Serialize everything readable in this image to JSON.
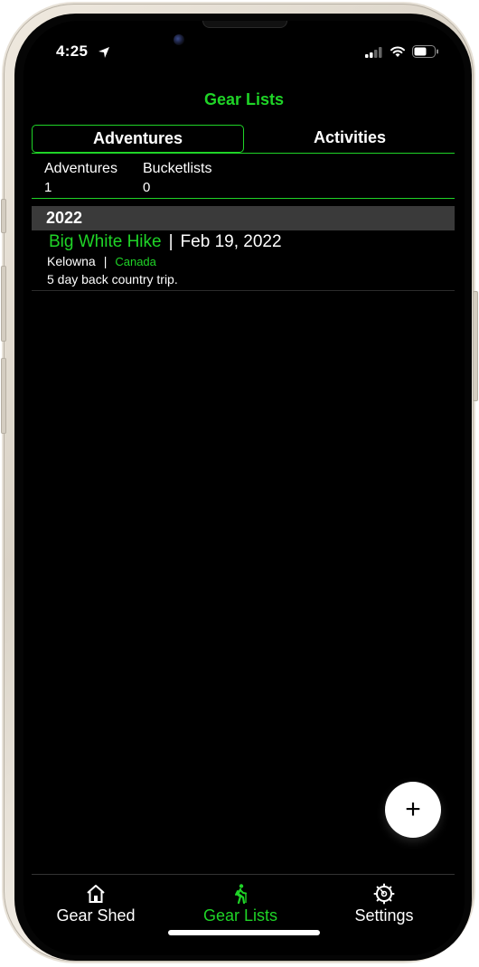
{
  "status_bar": {
    "time": "4:25"
  },
  "header": {
    "title": "Gear Lists"
  },
  "segments": [
    {
      "label": "Adventures",
      "active": true
    },
    {
      "label": "Activities",
      "active": false
    }
  ],
  "stats": [
    {
      "label": "Adventures",
      "value": "1"
    },
    {
      "label": "Bucketlists",
      "value": "0"
    }
  ],
  "sections": [
    {
      "year": "2022",
      "items": [
        {
          "name": "Big White Hike",
          "separator": "|",
          "date": "Feb 19, 2022",
          "city": "Kelowna",
          "loc_separator": "|",
          "country": "Canada",
          "description": "5 day back country trip."
        }
      ]
    }
  ],
  "fab": {
    "label": "+"
  },
  "tabbar": [
    {
      "label": "Gear Shed",
      "icon": "house-icon",
      "active": false
    },
    {
      "label": "Gear Lists",
      "icon": "hiker-icon",
      "active": true
    },
    {
      "label": "Settings",
      "icon": "gear-icon",
      "active": false
    }
  ],
  "colors": {
    "accent": "#1fd427",
    "background": "#000000",
    "section_bar": "#3a3a3a"
  }
}
